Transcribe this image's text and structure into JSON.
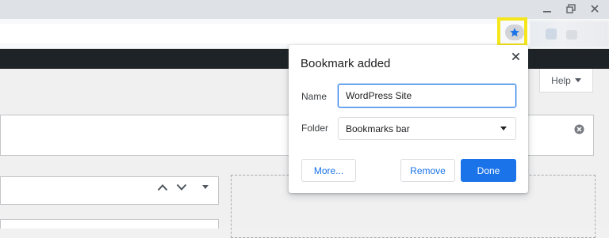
{
  "window": {
    "minimize_label": "minimize",
    "restore_label": "restore",
    "close_label": "close"
  },
  "page": {
    "help_label": "Help"
  },
  "bookmark_bubble": {
    "title": "Bookmark added",
    "name_label": "Name",
    "name_value": "WordPress Site",
    "folder_label": "Folder",
    "folder_value": "Bookmarks bar",
    "more_label": "More...",
    "remove_label": "Remove",
    "done_label": "Done"
  },
  "colors": {
    "accent": "#1a73e8",
    "highlight": "#f5e61b",
    "admin_bar": "#1d2327"
  }
}
